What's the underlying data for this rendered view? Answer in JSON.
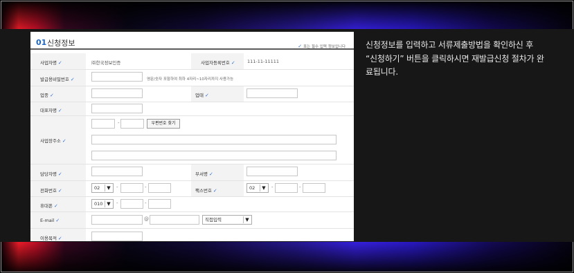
{
  "section": {
    "number": "01",
    "title": "신청정보",
    "required_note": "표는 필수 입력 정보입니다"
  },
  "check_glyph": "✓",
  "fields": {
    "company_name": {
      "label": "사업자명",
      "value": "㈜한국정보인증"
    },
    "business_reg_no": {
      "label": "사업자등록번호",
      "value": "111-11-11111"
    },
    "issue_password": {
      "label": "발급용비밀번호",
      "note": "영문/숫자 포함하여 최하 4자리~10자리까지 사용가능"
    },
    "industry": {
      "label": "업종"
    },
    "business_type": {
      "label": "업태"
    },
    "representative": {
      "label": "대표자명"
    },
    "address": {
      "label": "사업장주소",
      "postcode_button": "우편번호 찾기"
    },
    "contact_person": {
      "label": "담당자명"
    },
    "department": {
      "label": "부서명"
    },
    "phone": {
      "label": "전화번호",
      "area_code": "02"
    },
    "fax": {
      "label": "팩스번호",
      "area_code": "02"
    },
    "mobile": {
      "label": "휴대폰",
      "prefix": "010"
    },
    "email": {
      "label": "E-mail",
      "at": "@",
      "domain_select": "직접입력"
    },
    "purpose": {
      "label": "이용목적"
    }
  },
  "description": "신청정보를 입력하고 서류제출방법을 확인하신 후 “신청하기” 버튼을 클릭하시면 재발급신청 절차가 완료됩니다."
}
